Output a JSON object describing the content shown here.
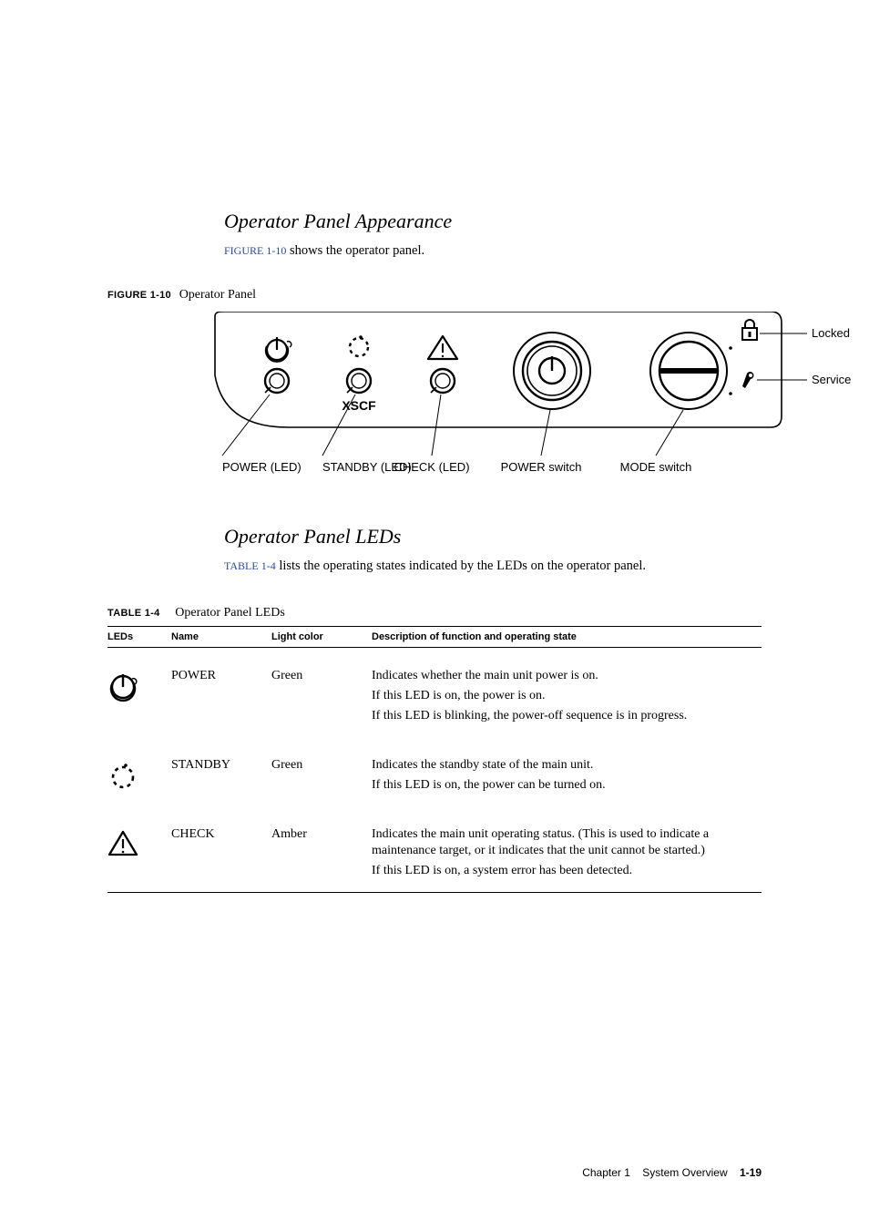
{
  "sec1": {
    "heading": "Operator Panel Appearance",
    "text_link": "FIGURE 1-10",
    "text_after": " shows the operator panel."
  },
  "figure": {
    "label": "FIGURE 1-10",
    "title": "Operator Panel",
    "labels": {
      "locked": "Locked",
      "service": "Service",
      "power_led": "POWER (LED)",
      "standby_led": "STANDBY (LED)",
      "check_led": "CHECK (LED)",
      "power_switch": "POWER switch",
      "mode_switch": "MODE switch",
      "xscf": "XSCF"
    }
  },
  "sec2": {
    "heading": "Operator Panel LEDs",
    "text_link": "TABLE 1-4",
    "text_after": " lists the operating states indicated by the LEDs on the operator panel."
  },
  "table": {
    "label": "TABLE 1-4",
    "title": "Operator Panel LEDs",
    "head": {
      "c1": "LEDs",
      "c2": "Name",
      "c3": "Light color",
      "c4": "Description of function and operating state"
    },
    "rows": [
      {
        "name": "POWER",
        "color": "Green",
        "desc": [
          "Indicates whether the main unit power is on.",
          "If this LED is on, the power is on.",
          "If this LED is blinking, the power-off sequence is in progress."
        ]
      },
      {
        "name": "STANDBY",
        "color": "Green",
        "desc": [
          "Indicates the standby state of the main unit.",
          "If this LED is on, the power can be turned on."
        ]
      },
      {
        "name": "CHECK",
        "color": "Amber",
        "desc": [
          "Indicates the main unit operating status. (This is used to indicate a maintenance target, or it indicates that the unit cannot be started.)",
          "If this LED is on, a system error has been detected."
        ]
      }
    ]
  },
  "footer": {
    "chapter": "Chapter 1",
    "section": "System Overview",
    "page": "1-19"
  }
}
